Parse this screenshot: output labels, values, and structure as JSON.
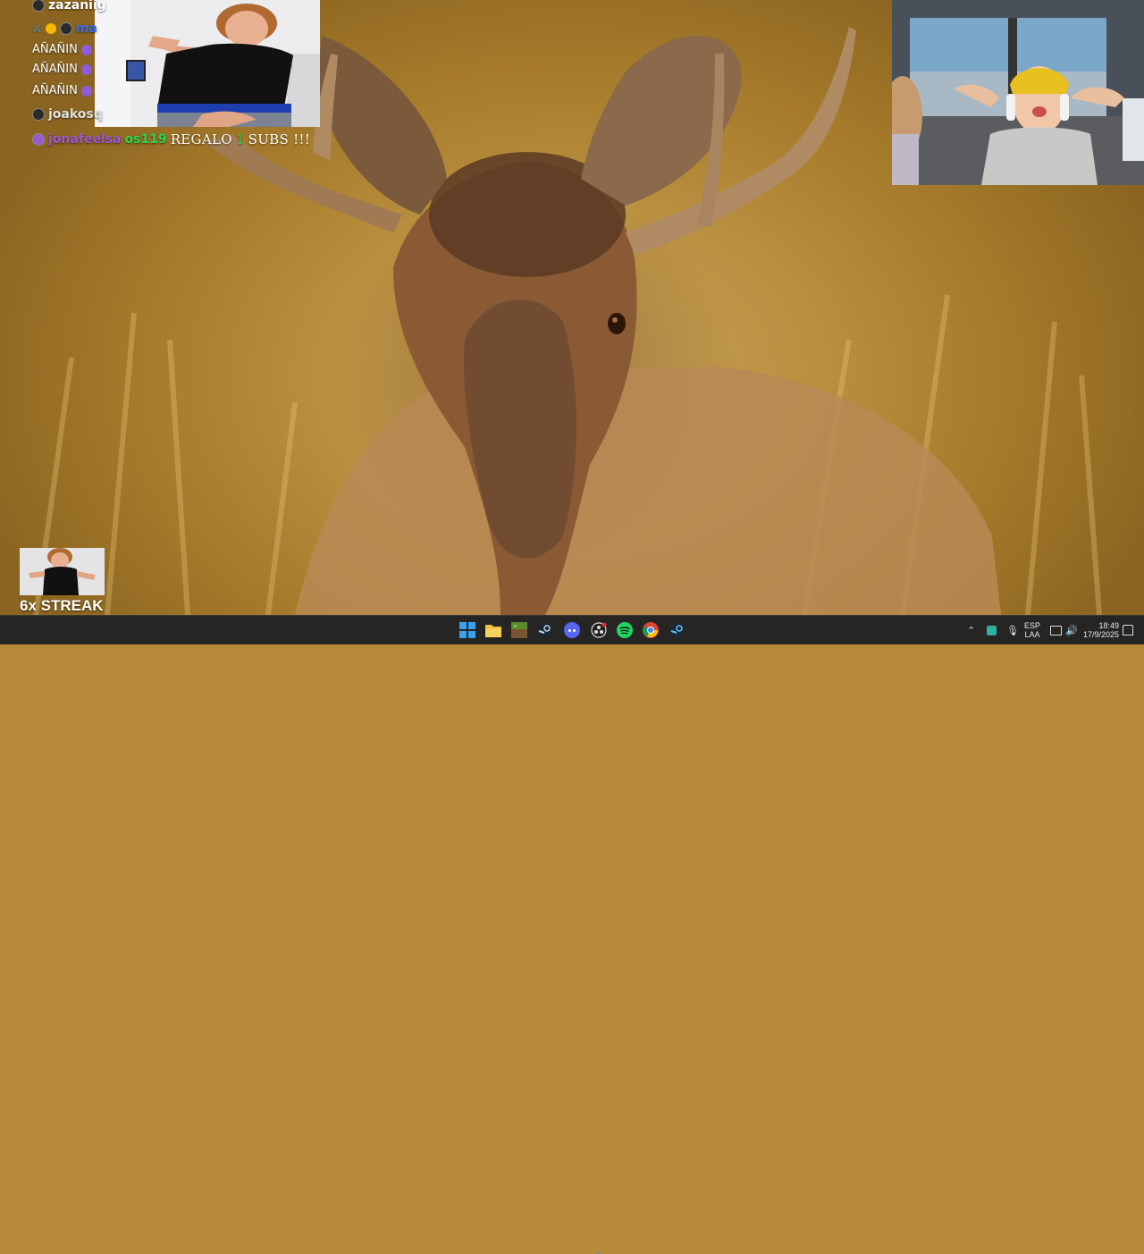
{
  "chat": {
    "messages": [
      {
        "user": "zazaniig",
        "text": "",
        "color": "#ffffff"
      },
      {
        "user": "ma",
        "text": "",
        "color": "#3a6ee8"
      },
      {
        "user": "",
        "text": "AÑAÑIN",
        "color": "#ffffff"
      },
      {
        "user": "",
        "text": "AÑAÑIN",
        "color": "#ffffff"
      },
      {
        "user": "",
        "text": "AÑAÑIN",
        "color": "#ffffff"
      },
      {
        "user": "joakosq",
        "text": "",
        "color": "#e0e0e0"
      },
      {
        "user": "jonafeelsa",
        "text": "",
        "color": "#9b59d0"
      }
    ],
    "gift": {
      "gifter": "os119",
      "prefix": "REGALO",
      "count": "1",
      "suffix": "SUBS !!!"
    }
  },
  "overlay": {
    "streak": "6x STREAK"
  },
  "tray": {
    "language_top": "ESP",
    "language_bottom": "LAA",
    "time": "18:49",
    "date": "17/9/2025"
  },
  "taskbar_icons": [
    "windows-start-icon",
    "file-explorer-icon",
    "minecraft-icon",
    "steam-icon",
    "discord-icon",
    "obs-icon",
    "spotify-icon",
    "chrome-icon",
    "steam-icon-2"
  ],
  "colors": {
    "taskbar": "#262523",
    "accent_green": "#2bd64f",
    "chat_purple": "#9b59d0"
  }
}
